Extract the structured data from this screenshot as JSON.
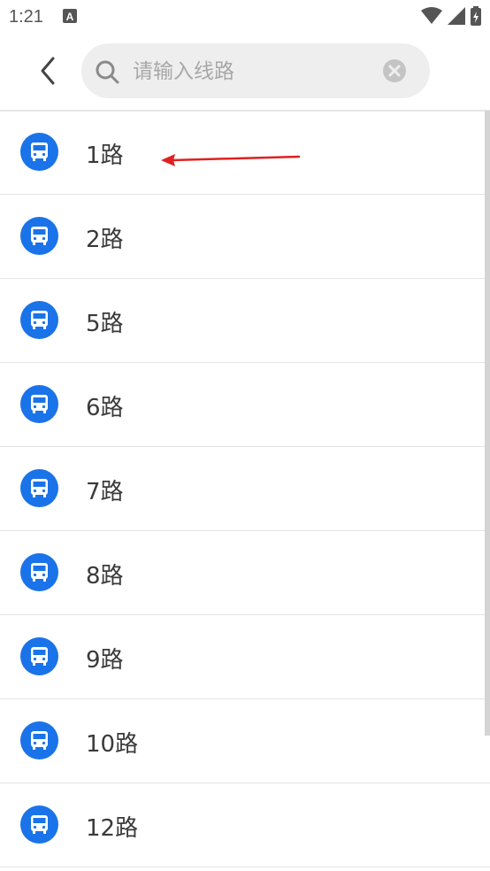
{
  "status_bar": {
    "time": "1:21"
  },
  "search": {
    "placeholder": "请输入线路",
    "value": ""
  },
  "routes": [
    {
      "label": "1路"
    },
    {
      "label": "2路"
    },
    {
      "label": "5路"
    },
    {
      "label": "6路"
    },
    {
      "label": "7路"
    },
    {
      "label": "8路"
    },
    {
      "label": "9路"
    },
    {
      "label": "10路"
    },
    {
      "label": "12路"
    }
  ],
  "colors": {
    "accent": "#1a73e8",
    "annotation": "#e02020"
  }
}
